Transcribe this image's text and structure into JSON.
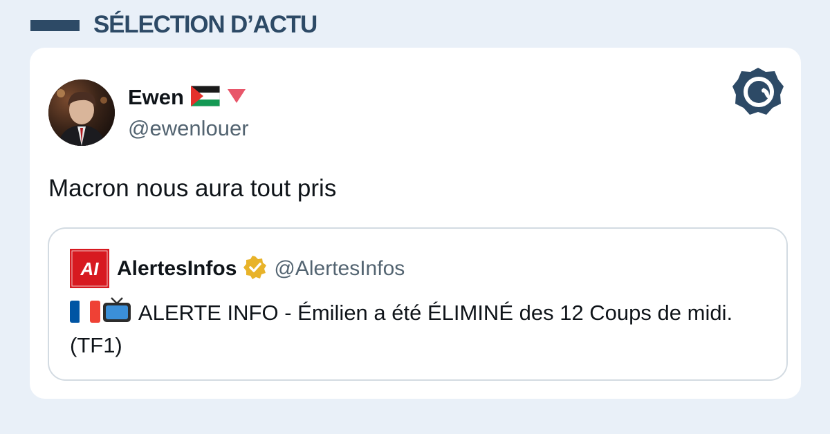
{
  "header": {
    "title": "SÉLECTION D’ACTU"
  },
  "tweet": {
    "author_name": "Ewen",
    "author_handle": "@ewenlouer",
    "author_name_icons": [
      "palestine-flag-icon",
      "red-triangle-down-icon"
    ],
    "text": "Macron nous aura tout pris"
  },
  "quoted_tweet": {
    "author_name": "AlertesInfos",
    "author_handle": "@AlertesInfos",
    "verified": true,
    "logo_text": "AI",
    "text_icons": [
      "france-flag-icon",
      "television-icon"
    ],
    "text": "ALERTE INFO - Émilien a été ÉLIMINÉ des 12 Coups de midi. (TF1)"
  },
  "colors": {
    "background": "#e9f0f8",
    "brand": "#2d4a66",
    "logo_red": "#d71920",
    "verified_gold": "#e8b32a",
    "text_primary": "#0f1419",
    "text_secondary": "#536471"
  }
}
